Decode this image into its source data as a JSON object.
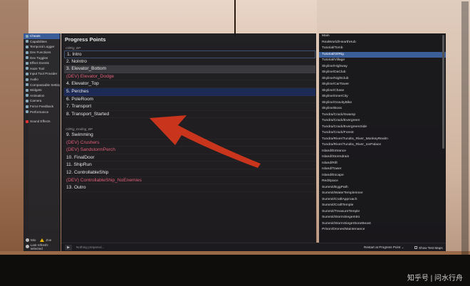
{
  "sidebar": {
    "items": [
      {
        "label": "Cheats",
        "icon": "monitor-icon",
        "active": true
      },
      {
        "label": "Capabilities",
        "icon": "capabilities-icon"
      },
      {
        "label": "Temporal Logger",
        "icon": "logger-icon"
      },
      {
        "label": "Dev Functions",
        "icon": "function-icon"
      },
      {
        "label": "Dev Toggles",
        "icon": "toggle-icon"
      },
      {
        "label": "Effect Events",
        "icon": "effect-icon"
      },
      {
        "label": "Haze Tool",
        "icon": "haze-icon"
      },
      {
        "label": "Input Tool Provider",
        "icon": "input-icon"
      },
      {
        "label": "Audio",
        "icon": "audio-icon"
      },
      {
        "label": "Compassable Settings",
        "icon": "compass-icon"
      },
      {
        "label": "Widgets",
        "icon": "widget-icon"
      },
      {
        "label": "Animation",
        "icon": "animation-icon"
      },
      {
        "label": "Camera",
        "icon": "camera-icon"
      },
      {
        "label": "Force Feedback",
        "icon": "force-feedback-icon"
      },
      {
        "label": "Performance",
        "icon": "performance-icon"
      },
      {
        "label": "Sound Effects",
        "icon": "sound-icon",
        "red": true
      }
    ],
    "bottom": {
      "user1": "Mio",
      "user2": "Zoe",
      "version_text": "Last refresh: selected"
    }
  },
  "panel": {
    "title": "Progress Points"
  },
  "groups": [
    {
      "label": "OilRig_BP",
      "items": [
        {
          "text": "1. Intro"
        },
        {
          "text": "2. NoIntro"
        },
        {
          "text": "3. Elevator_Bottom",
          "state": "hover"
        },
        {
          "text": "(DEV) Elevator_Dodge",
          "dev": true
        },
        {
          "text": "4. Elevator_Top"
        },
        {
          "text": "5. Perches",
          "state": "selected"
        },
        {
          "text": "6. PoleRoom"
        },
        {
          "text": "7. Transport"
        },
        {
          "text": "8. Transport_Started"
        }
      ]
    },
    {
      "label": "OilRig_Ending_BP",
      "items": [
        {
          "text": "9. Swimming"
        },
        {
          "text": "(DEV) Crushers",
          "dev": true
        },
        {
          "text": "(DEV) SandstormPerch",
          "dev": true
        },
        {
          "text": "10. FinalDoor"
        },
        {
          "text": "11. ShipRun"
        },
        {
          "text": "12. ControllableShip"
        },
        {
          "text": "(DEV) ControllableShip_NoEnemies",
          "dev": true
        },
        {
          "text": "13. Outro"
        }
      ]
    }
  ],
  "chapters": {
    "items": [
      "Main",
      "RealWorld/HearthHub",
      "Tutorial/Tomb",
      "Tutorial/OilRig",
      "Tutorial/Village",
      "Skyline/Highway",
      "Skyline/DaClub",
      "Skyline/Nightclub",
      "Skyline/CarTower",
      "Skyline/Chase",
      "Skyline/InnerCity",
      "Skyline/GravityBike",
      "Skyline/Boss",
      "Tundra/Crack/Swamp",
      "Tundra/Crack/Evergreen",
      "Tundra/Crack/EvergreenSide",
      "Tundra/Crack/Forest",
      "Tundra/River/Tundra_River_MonkeyRealm",
      "Tundra/River/Tundra_River_IcePalace",
      "Island/Entrance",
      "Island/Stormdrain",
      "Island/Rift",
      "Island/Tower",
      "Island/Escape",
      "RedSpace",
      "Summit/EggPath",
      "Summit/WaterTempleInner",
      "Summit/CraftApproach",
      "Summit/CraftTemple",
      "Summit/TreasureTemple",
      "Summit/StormSiegeIntro",
      "Summit/StormSiegeStoneBeast",
      "Prison/Drones/Maintenance"
    ],
    "selected_index": 3
  },
  "footer": {
    "play_symbol": "▶",
    "status": "Nothing prepared...",
    "restart_label": "Restart at Progress Point ⌄",
    "show_test_maps_label": "Show Test Maps"
  },
  "watermark": "知乎号 | 问水行舟",
  "colors": {
    "dev_red": "#e0607a",
    "selected_blue": "#1d2a55",
    "chapter_selected": "#3b5f98",
    "arrow_red": "#d8361c"
  }
}
